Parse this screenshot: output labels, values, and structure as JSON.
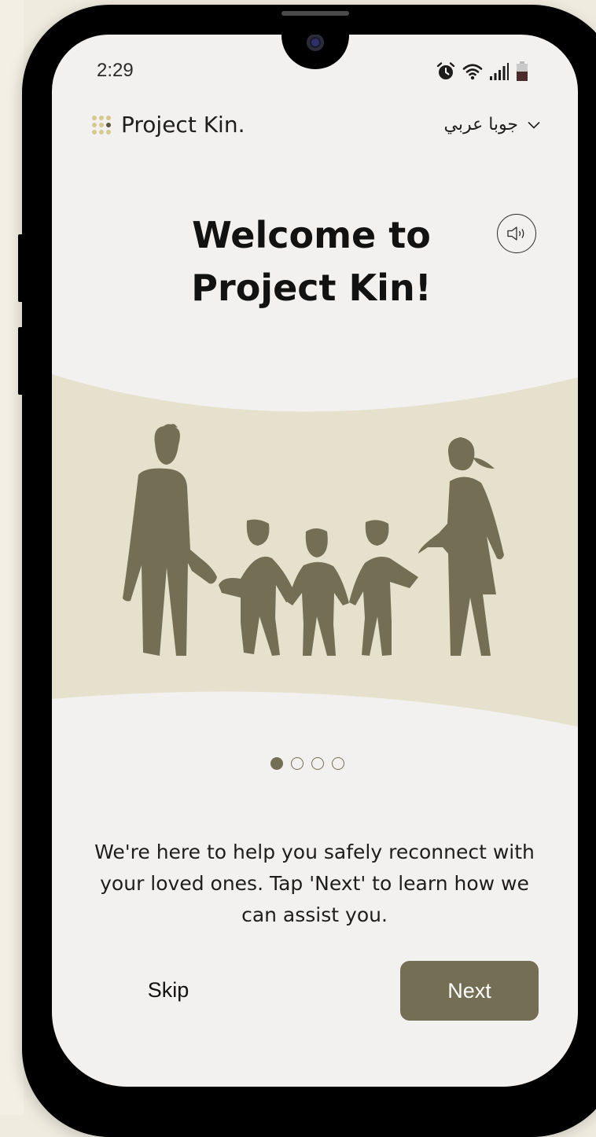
{
  "status_bar": {
    "time": "2:29",
    "icons": [
      "alarm-icon",
      "wifi-icon",
      "signal-icon",
      "battery-icon"
    ]
  },
  "header": {
    "brand_name": "Project Kin.",
    "language_selected": "جوبا عربي"
  },
  "welcome": {
    "title_line1": "Welcome to",
    "title_line2": "Project Kin!",
    "audio_icon": "speaker-icon"
  },
  "hero": {
    "image": "family-holding-hands-illustration"
  },
  "pagination": {
    "total": 4,
    "current": 1
  },
  "description": "We're here to help you safely reconnect with your loved ones. Tap 'Next' to learn how we can assist you.",
  "actions": {
    "skip_label": "Skip",
    "next_label": "Next"
  },
  "colors": {
    "accent": "#746e54",
    "hero_band": "#e5e1cc",
    "logo_dots": "#d6c98e",
    "screen_bg": "#f2f1ef"
  }
}
